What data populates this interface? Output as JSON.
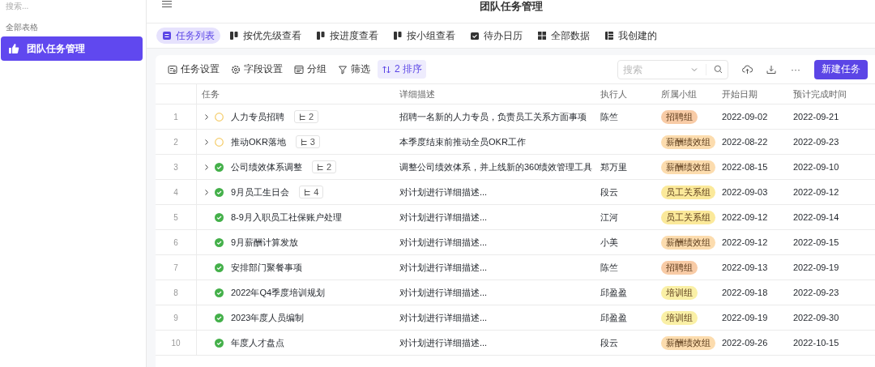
{
  "sidebar": {
    "search": {
      "placeholder": "搜索..."
    },
    "section_label": "全部表格",
    "items": [
      {
        "label": "团队任务管理",
        "selected": true
      }
    ]
  },
  "header": {
    "title": "团队任务管理"
  },
  "view_tabs": [
    {
      "label": "任务列表",
      "selected": true
    },
    {
      "label": "按优先级查看",
      "selected": false
    },
    {
      "label": "按进度查看",
      "selected": false
    },
    {
      "label": "按小组查看",
      "selected": false
    },
    {
      "label": "待办日历",
      "selected": false
    },
    {
      "label": "全部数据",
      "selected": false
    },
    {
      "label": "我创建的",
      "selected": false
    }
  ],
  "toolbar": {
    "actions": [
      {
        "label": "任务设置",
        "active": false
      },
      {
        "label": "字段设置",
        "active": false
      },
      {
        "label": "分组",
        "active": false
      },
      {
        "label": "筛选",
        "active": false
      },
      {
        "label": "2 排序",
        "active": true
      }
    ],
    "search": {
      "placeholder": "搜索"
    },
    "more": "···",
    "new_button": "新建任务"
  },
  "table": {
    "columns": [
      "任务",
      "详细描述",
      "执行人",
      "所属小组",
      "开始日期",
      "预计完成时间"
    ],
    "rows": [
      {
        "index": "1",
        "expandable": true,
        "done": false,
        "task": "人力专员招聘",
        "subtasks": "2",
        "description": "招聘一名新的人力专员，负责员工关系方面事项",
        "assignee": "陈竺",
        "group": {
          "label": "招聘组",
          "color": "#f8cba6"
        },
        "start": "2022-09-02",
        "end": "2022-09-21"
      },
      {
        "index": "2",
        "expandable": true,
        "done": false,
        "task": "推动OKR落地",
        "subtasks": "3",
        "description": "本季度结束前推动全员OKR工作",
        "group": {
          "label": "薪酬绩效组",
          "color": "#fcdcae"
        },
        "start": "2022-08-22",
        "end": "2022-09-23"
      },
      {
        "index": "3",
        "expandable": true,
        "done": true,
        "task": "公司绩效体系调整",
        "subtasks": "2",
        "description": "调整公司绩效体系，并上线新的360绩效管理工具",
        "assignee": "郑万里",
        "group": {
          "label": "薪酬绩效组",
          "color": "#fcdcae"
        },
        "start": "2022-08-15",
        "end": "2022-09-10"
      },
      {
        "index": "4",
        "expandable": true,
        "done": true,
        "task": "9月员工生日会",
        "subtasks": "4",
        "description": "对计划进行详细描述...",
        "assignee": "段云",
        "group": {
          "label": "员工关系组",
          "color": "#fbe99a"
        },
        "start": "2022-09-03",
        "end": "2022-09-12"
      },
      {
        "index": "5",
        "expandable": false,
        "done": true,
        "task": "8-9月入职员工社保账户处理",
        "description": "对计划进行详细描述...",
        "assignee": "江河",
        "group": {
          "label": "员工关系组",
          "color": "#fbe99a"
        },
        "start": "2022-09-12",
        "end": "2022-09-14"
      },
      {
        "index": "6",
        "expandable": false,
        "done": true,
        "task": "9月薪酬计算发放",
        "description": "对计划进行详细描述...",
        "assignee": "小美",
        "group": {
          "label": "薪酬绩效组",
          "color": "#fcdcae"
        },
        "start": "2022-09-12",
        "end": "2022-09-15"
      },
      {
        "index": "7",
        "expandable": false,
        "done": true,
        "task": "安排部门聚餐事项",
        "description": "对计划进行详细描述...",
        "assignee": "陈竺",
        "group": {
          "label": "招聘组",
          "color": "#f8cba6"
        },
        "start": "2022-09-13",
        "end": "2022-09-19"
      },
      {
        "index": "8",
        "expandable": false,
        "done": true,
        "task": "2022年Q4季度培训规划",
        "description": "对计划进行详细描述...",
        "assignee": "邱盈盈",
        "group": {
          "label": "培训组",
          "color": "#faf0a6"
        },
        "start": "2022-09-18",
        "end": "2022-09-23"
      },
      {
        "index": "9",
        "expandable": false,
        "done": true,
        "task": "2023年度人员编制",
        "description": "对计划进行详细描述...",
        "assignee": "邱盈盈",
        "group": {
          "label": "培训组",
          "color": "#faf0a6"
        },
        "start": "2022-09-19",
        "end": "2022-09-30"
      },
      {
        "index": "10",
        "expandable": false,
        "done": true,
        "task": "年度人才盘点",
        "description": "对计划进行详细描述...",
        "assignee": "段云",
        "group": {
          "label": "薪酬绩效组",
          "color": "#fcdcae"
        },
        "start": "2022-09-26",
        "end": "2022-10-15"
      }
    ]
  }
}
